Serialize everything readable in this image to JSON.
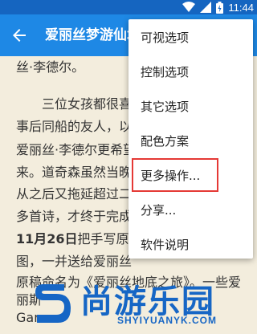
{
  "status_bar": {
    "time": "11:44"
  },
  "app_bar": {
    "title": "爱丽丝梦游仙境",
    "back_icon": "arrow-back-icon"
  },
  "content": {
    "lines": [
      "丝·李德尔。",
      "三位女孩都很喜",
      "事后同船的友人，以",
      "爱丽丝·李德尔更希望",
      "来。道奇森虽然当晚",
      "从之后又拖延超过二",
      "多首诗，才终于完成",
      "图，一并送给爱丽丝",
      "原稿命名为《爱丽丝地底之旅》。一些爱",
      "丽斯",
      "Gar"
    ],
    "bold_date": "11月26日",
    "bold_line_rest": "把手写原稿"
  },
  "menu": {
    "items": [
      "可视选项",
      "控制选项",
      "其它选项",
      "配色方案",
      "更多操作...",
      "分享...",
      "软件说明"
    ],
    "highlighted_index": 4,
    "highlight_color": "#e53935"
  },
  "watermark": {
    "text": "尚游乐园",
    "url": "SHYIYUANYK.COM"
  },
  "colors": {
    "status_bar": "#1565c0",
    "app_bar": "#1e88e5",
    "page_bg": "#f3eddd",
    "watermark": "#1666c5"
  }
}
